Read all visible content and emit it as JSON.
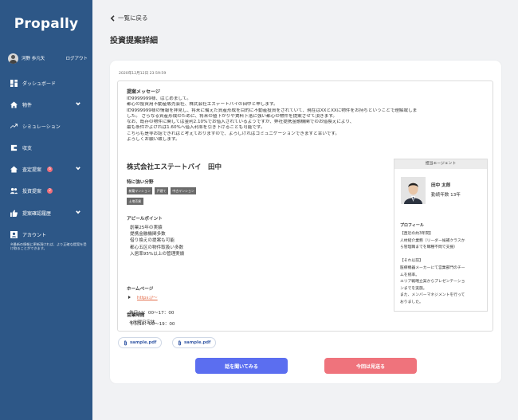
{
  "app": {
    "name": "Propally"
  },
  "user": {
    "name": "河野 歩凡矢",
    "logout_label": "ログアウト"
  },
  "sidebar": {
    "items": [
      {
        "label": "ダッシュボード"
      },
      {
        "label": "物件"
      },
      {
        "label": "シミュレーション"
      },
      {
        "label": "収支"
      },
      {
        "label": "査定提案",
        "badge": "6"
      },
      {
        "label": "投資提案",
        "badge": "2"
      },
      {
        "label": "提案確認履歴"
      },
      {
        "label": "アカウント"
      }
    ],
    "account_note": "※最新の情報に更新頂ければ、より正確な提案を受け取ることができます。"
  },
  "header": {
    "back_label": "一覧に戻る",
    "title": "投資提案詳細"
  },
  "proposal": {
    "timestamp": "2020年12月12日 23:59:59",
    "message_title": "提案メッセージ",
    "message_lines": [
      "ID9999999様、はじめまして。",
      "都心の投資用不動産販売会社、株式会社エステートバイの田中と申します。",
      "ID9999999様の情報を拝見し、将来に備えた資産形成を目的に不動産投資をされていて、現在はXXとXXに物件をお持ちということで理解致しま",
      "した。 さらなる資産形成のために、将来の値下がりや賃料下落に強い都心の物件を提案させて頂きます。",
      "なお、既存の物件に関しては金利2.10%でお借入されているようですが、弊社提携金融機関でのお借換えにより、",
      "最も条件がよければ1.60%へ借入利率を引き下げることも可能です。",
      "こちらも是非お話できればと考えておりますので、よろしければコミュニケーションできますと幸いです。",
      "よろしくお願い致します。"
    ],
    "company": "株式会社エステートバイ　田中",
    "strengths_title": "特に強い分野",
    "strengths": [
      "新築マンション",
      "戸建て",
      "中古マンション",
      "土地売買"
    ],
    "appeal_title": "アピールポイント",
    "appeal_lines": [
      "創業25年の実績",
      "提携金融機関多数",
      "借り換えの提案も可能",
      "都心五区の物件取扱い多数",
      "入居率95%以上の管理実績"
    ],
    "homepage_title": "ホームページ",
    "homepage_url": "https://〜",
    "hours_title": "営業時間",
    "hours_weekday": "平日10：00〜19：00",
    "hours_holiday": "休日12：00〜17：00",
    "hours_note": "※水曜日定休",
    "agent": {
      "header": "担当エージェント",
      "name": "田中 太郎",
      "years": "勤続年数 13年",
      "profile_title": "プロフィール",
      "profile_lines": [
        "【直近の約3年間】",
        "人材紹介業務（リーダー候補クラスか",
        "ら管理職までを職種不問で支援）",
        "",
        "【それ以前】",
        "医療機器メーカーにて営業部門のチー",
        "ムを統率。",
        "エリア戦略立案からプレゼンテーショ",
        "ンまでを実施。",
        "また、メンバーマネジメントを行って",
        "おりました。"
      ]
    },
    "attachments": [
      "sample.pdf",
      "sample.pdf"
    ],
    "primary_button": "話を聞いてみる",
    "secondary_button": "今回は見送る"
  },
  "colors": {
    "sidebar": "#2d5787",
    "primary": "#5b6ef0",
    "secondary": "#ef737c",
    "link": "#e36a47",
    "badge": "#f06e7a"
  }
}
